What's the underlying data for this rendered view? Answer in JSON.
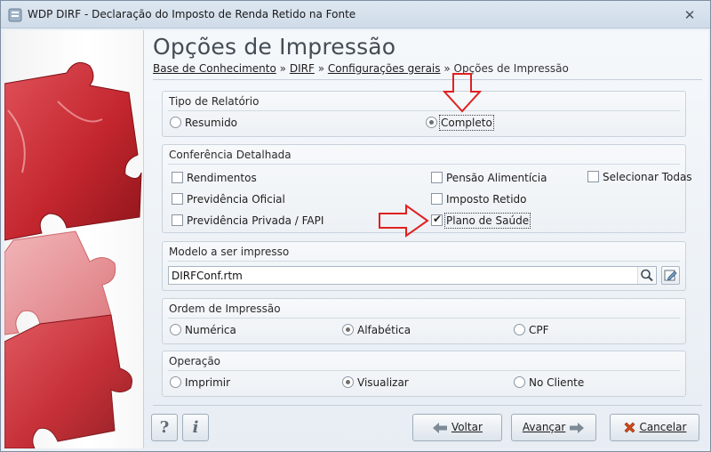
{
  "window": {
    "title": "WDP DIRF - Declaração do Imposto de Renda Retido na Fonte",
    "close_glyph": "✕"
  },
  "header": {
    "title": "Opções de Impressão",
    "breadcrumb": [
      {
        "label": "Base de Conhecimento",
        "link": true
      },
      {
        "label": "DIRF",
        "link": true
      },
      {
        "label": "Configurações gerais",
        "link": true
      },
      {
        "label": "Opções de Impressão",
        "link": false
      }
    ],
    "separator": "»"
  },
  "report_type": {
    "title": "Tipo de Relatório",
    "options": [
      {
        "label": "Resumido",
        "selected": false
      },
      {
        "label": "Completo",
        "selected": true
      }
    ]
  },
  "detail_check": {
    "title": "Conferência Detalhada",
    "items": [
      {
        "label": "Rendimentos",
        "checked": false
      },
      {
        "label": "Previdência Oficial",
        "checked": false
      },
      {
        "label": "Previdência Privada / FAPI",
        "checked": false
      },
      {
        "label": "Pensão Alimentícia",
        "checked": false
      },
      {
        "label": "Imposto Retido",
        "checked": false
      },
      {
        "label": "Plano de Saúde",
        "checked": true
      },
      {
        "label": "Selecionar Todas",
        "checked": false
      }
    ]
  },
  "model": {
    "title": "Modelo a ser impresso",
    "value": "DIRFConf.rtm"
  },
  "order": {
    "title": "Ordem de Impressão",
    "options": [
      {
        "label": "Numérica",
        "selected": false
      },
      {
        "label": "Alfabética",
        "selected": true
      },
      {
        "label": "CPF",
        "selected": false
      }
    ]
  },
  "operation": {
    "title": "Operação",
    "options": [
      {
        "label": "Imprimir",
        "selected": false
      },
      {
        "label": "Visualizar",
        "selected": true
      },
      {
        "label": "No Cliente",
        "selected": false
      }
    ]
  },
  "footer": {
    "help_glyph": "?",
    "info_glyph": "i",
    "back_label": "Voltar",
    "next_label": "Avançar",
    "cancel_label": "Cancelar"
  },
  "colors": {
    "annotation_arrow": "#e02020",
    "puzzle_red": "#c4262e",
    "cancel_icon": "#d04a1c",
    "nav_arrow": "#7d8a96"
  },
  "icons": [
    "app-icon",
    "close-icon",
    "search-icon",
    "edit-icon",
    "help-icon",
    "info-icon",
    "arrow-left-icon",
    "arrow-right-icon",
    "cancel-x-icon",
    "annotation-arrow-down-icon",
    "annotation-arrow-right-icon"
  ]
}
